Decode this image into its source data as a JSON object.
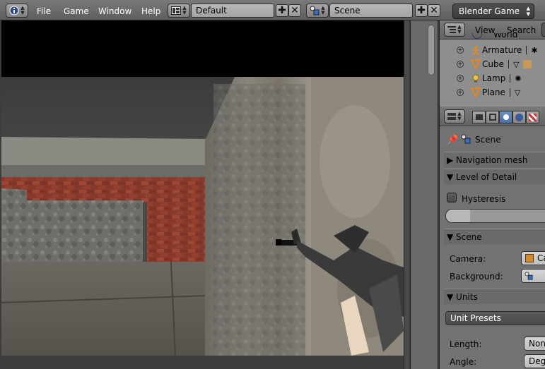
{
  "menu": {
    "file": "File",
    "game": "Game",
    "window": "Window",
    "help": "Help"
  },
  "screen_layout": {
    "value": "Default"
  },
  "scene_selector": {
    "value": "Scene"
  },
  "render_engine": {
    "value": "Blender Game"
  },
  "outliner": {
    "view_label": "View",
    "search_label": "Search",
    "items": [
      {
        "label": "World",
        "icon": "world-icon"
      },
      {
        "label": "Armature",
        "icon": "armature-icon"
      },
      {
        "label": "Cube",
        "icon": "mesh-icon"
      },
      {
        "label": "Lamp",
        "icon": "lamp-icon"
      },
      {
        "label": "Plane",
        "icon": "mesh-icon"
      }
    ]
  },
  "properties": {
    "context_label": "Scene",
    "panels": {
      "navigation_mesh": "Navigation mesh",
      "level_of_detail": "Level of Detail",
      "hysteresis": "Hysteresis",
      "scene": "Scene",
      "camera_label": "Camera:",
      "camera_value": "Ca",
      "background_label": "Background:",
      "units": "Units",
      "unit_presets": "Unit Presets",
      "length_label": "Length:",
      "length_value": "None",
      "angle_label": "Angle:",
      "angle_value": "Degr"
    }
  },
  "colors": {
    "header_bg": "#6b6b6b",
    "panel_bg": "#727272",
    "active_tab": "#5680c2"
  }
}
